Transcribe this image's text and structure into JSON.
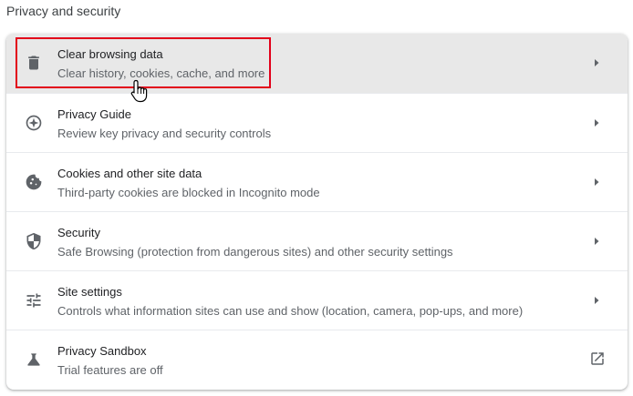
{
  "section": {
    "title": "Privacy and security"
  },
  "items": [
    {
      "label": "Clear browsing data",
      "sublabel": "Clear history, cookies, cache, and more",
      "icon": "trash-icon",
      "action": "chevron-right-icon"
    },
    {
      "label": "Privacy Guide",
      "sublabel": "Review key privacy and security controls",
      "icon": "compass-icon",
      "action": "chevron-right-icon"
    },
    {
      "label": "Cookies and other site data",
      "sublabel": "Third-party cookies are blocked in Incognito mode",
      "icon": "cookie-icon",
      "action": "chevron-right-icon"
    },
    {
      "label": "Security",
      "sublabel": "Safe Browsing (protection from dangerous sites) and other security settings",
      "icon": "shield-icon",
      "action": "chevron-right-icon"
    },
    {
      "label": "Site settings",
      "sublabel": "Controls what information sites can use and show (location, camera, pop-ups, and more)",
      "icon": "sliders-icon",
      "action": "chevron-right-icon"
    },
    {
      "label": "Privacy Sandbox",
      "sublabel": "Trial features are off",
      "icon": "flask-icon",
      "action": "external-link-icon"
    }
  ],
  "colors": {
    "highlight_border": "#e2001a",
    "hover_background": "#e8e8e8",
    "icon": "#5f6368"
  }
}
